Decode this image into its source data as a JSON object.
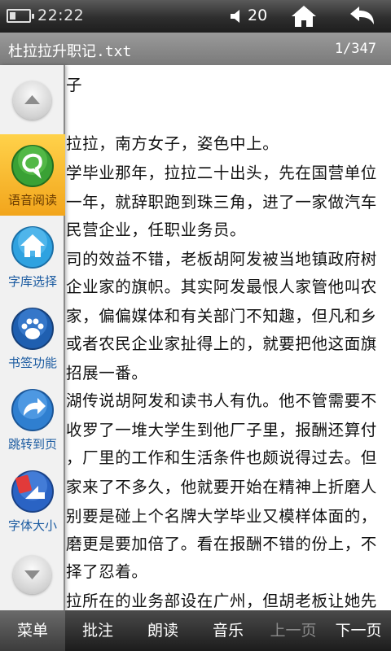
{
  "status_bar": {
    "time": "22:22",
    "volume": "20",
    "battery_level": 0.25,
    "icons": [
      "battery-icon",
      "speaker-icon",
      "home-icon",
      "back-arrow-icon"
    ]
  },
  "title_bar": {
    "title": "杜拉拉升职记.txt",
    "page": "1/347"
  },
  "content": {
    "lines": [
      "子",
      "",
      "拉拉，南方女子，姿色中上。",
      "学毕业那年，拉拉二十出头，先在国营单位",
      "一年，就辞职跑到珠三角，进了一家做汽车",
      "民营企业，任职业务员。",
      "司的效益不错，老板胡阿发被当地镇政府树",
      "企业家的旗帜。其实阿发最恨人家管他叫农",
      "家，偏偏媒体和有关部门不知趣，但凡和乡",
      "或者农民企业家扯得上的，就要把他这面旗",
      "招展一番。",
      "湖传说胡阿发和读书人有仇。他不管需要不",
      "收罗了一堆大学生到他厂子里，报酬还算付",
      "，厂里的工作和生活条件也颇说得过去。但",
      "家来了不多久，他就要开始在精神上折磨人",
      "别要是碰上个名牌大学毕业又模样体面的，",
      "磨更是要加倍了。看在报酬不错的份上，不",
      "择了忍着。",
      "拉所在的业务部设在广州，但胡老板让她先"
    ]
  },
  "sidebar": {
    "tools": [
      {
        "label": "语音阅读",
        "icon": "speech-bubble-icon",
        "active": true
      },
      {
        "label": "字库选择",
        "icon": "house-icon",
        "active": false
      },
      {
        "label": "书签功能",
        "icon": "paw-icon",
        "active": false
      },
      {
        "label": "跳转到页",
        "icon": "curved-arrow-icon",
        "active": false
      },
      {
        "label": "字体大小",
        "icon": "arrow-cards-icon",
        "active": false
      }
    ]
  },
  "menu_bar": {
    "items": [
      {
        "label": "菜单",
        "state": "selected"
      },
      {
        "label": "批注",
        "state": "normal"
      },
      {
        "label": "朗读",
        "state": "normal"
      },
      {
        "label": "音乐",
        "state": "normal"
      },
      {
        "label": "上一页",
        "state": "disabled"
      },
      {
        "label": "下一页",
        "state": "normal"
      }
    ]
  },
  "colors": {
    "accent_highlight": "#f2a51c",
    "sidebar_label": "#1a5aa0",
    "status_bar": "#2e2e2e",
    "title_bar": "#8a8a8a"
  }
}
